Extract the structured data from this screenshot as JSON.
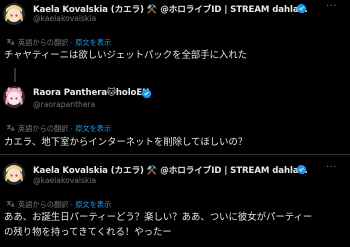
{
  "tweets": [
    {
      "name": "Kaela Kovalskia (カエラ) ⚒️ @ホロライブID | STREAM dahlah.",
      "handle": "@kaelakovalskia",
      "translated_label": "英語からの翻訳",
      "show_original": "原文を表示",
      "text": "チャヤティーニは欲しいジェットパックを全部手に入れた",
      "avatar_color": "#f3d38a"
    },
    {
      "name": "Raora Panthera🐱holoEN",
      "handle": "@raorapanthera",
      "translated_label": "英語からの翻訳",
      "show_original": "原文を表示",
      "text": "カエラ、地下室からインターネットを削除してほしいの？",
      "avatar_color": "#f4a9c4"
    },
    {
      "name": "Kaela Kovalskia (カエラ) ⚒️ @ホロライブID | STREAM dahlah.",
      "handle": "@kaelakovalskia",
      "translated_label": "英語からの翻訳",
      "show_original": "原文を表示",
      "text_line1": "ああ、お誕生日パーティーどう？楽しい？ああ、ついに彼女がパーティー",
      "text_line2": "の残り物を持ってきてくれる！やったー",
      "avatar_color": "#f3d38a"
    }
  ],
  "colors": {
    "verified": "#1d9bf0",
    "link": "#1d9bf0",
    "secondary_text": "#71767b"
  },
  "more_label": "···"
}
